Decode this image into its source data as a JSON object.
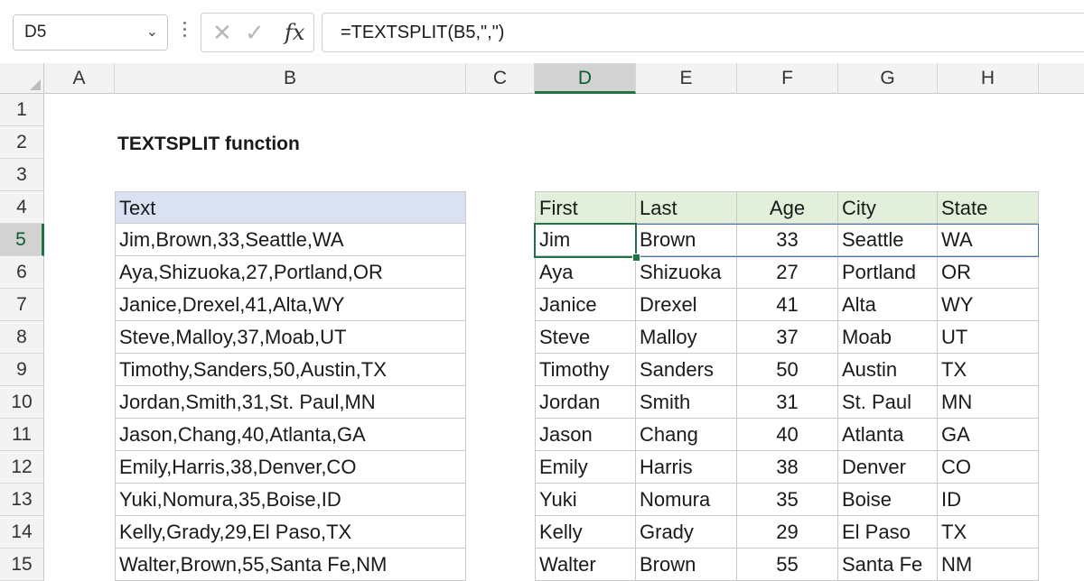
{
  "name_box": {
    "value": "D5",
    "chevron_icon": "chevron-down-icon"
  },
  "formula_bar": {
    "cancel_icon": "close-icon",
    "enter_icon": "check-icon",
    "fx_label": "fx",
    "formula": "=TEXTSPLIT(B5,\",\")"
  },
  "columns": [
    "A",
    "B",
    "C",
    "D",
    "E",
    "F",
    "G",
    "H"
  ],
  "selected_column": "D",
  "rows": [
    "1",
    "2",
    "3",
    "4",
    "5",
    "6",
    "7",
    "8",
    "9",
    "10",
    "11",
    "12",
    "13",
    "14",
    "15"
  ],
  "selected_row": "5",
  "title": "TEXTSPLIT function",
  "source": {
    "header": "Text",
    "values": [
      "Jim,Brown,33,Seattle,WA",
      "Aya,Shizuoka,27,Portland,OR",
      "Janice,Drexel,41,Alta,WY",
      "Steve,Malloy,37,Moab,UT",
      "Timothy,Sanders,50,Austin,TX",
      "Jordan,Smith,31,St. Paul,MN",
      "Jason,Chang,40,Atlanta,GA",
      "Emily,Harris,38,Denver,CO",
      "Yuki,Nomura,35,Boise,ID",
      "Kelly,Grady,29,El Paso,TX",
      "Walter,Brown,55,Santa Fe,NM"
    ]
  },
  "result": {
    "headers": [
      "First",
      "Last",
      "Age",
      "City",
      "State"
    ],
    "rows": [
      [
        "Jim",
        "Brown",
        "33",
        "Seattle",
        "WA"
      ],
      [
        "Aya",
        "Shizuoka",
        "27",
        "Portland",
        "OR"
      ],
      [
        "Janice",
        "Drexel",
        "41",
        "Alta",
        "WY"
      ],
      [
        "Steve",
        "Malloy",
        "37",
        "Moab",
        "UT"
      ],
      [
        "Timothy",
        "Sanders",
        "50",
        "Austin",
        "TX"
      ],
      [
        "Jordan",
        "Smith",
        "31",
        "St. Paul",
        "MN"
      ],
      [
        "Jason",
        "Chang",
        "40",
        "Atlanta",
        "GA"
      ],
      [
        "Emily",
        "Harris",
        "38",
        "Denver",
        "CO"
      ],
      [
        "Yuki",
        "Nomura",
        "35",
        "Boise",
        "ID"
      ],
      [
        "Kelly",
        "Grady",
        "29",
        "El Paso",
        "TX"
      ],
      [
        "Walter",
        "Brown",
        "55",
        "Santa Fe",
        "NM"
      ]
    ]
  },
  "colors": {
    "accent": "#217346",
    "source_header_fill": "#d9e1f2",
    "result_header_fill": "#e2efda",
    "row_highlight": "#4472c4"
  }
}
